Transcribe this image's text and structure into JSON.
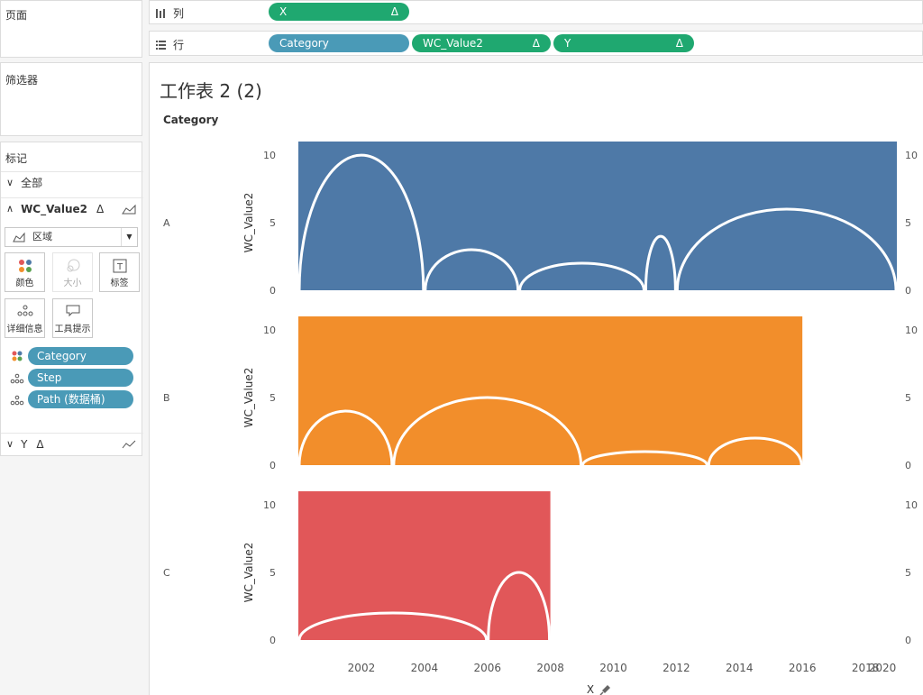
{
  "shelves": {
    "pages_label": "页面",
    "columns_label": "列",
    "rows_label": "行",
    "columns_pills": [
      {
        "label": "X",
        "delta": "Δ"
      }
    ],
    "rows_pills": [
      {
        "label": "Category",
        "delta": ""
      },
      {
        "label": "WC_Value2",
        "delta": "Δ"
      },
      {
        "label": "Y",
        "delta": "Δ"
      }
    ]
  },
  "filters": {
    "title": "筛选器"
  },
  "marks": {
    "title": "标记",
    "all_label": "全部",
    "layer1_label": "WC_Value2",
    "layer1_delta": "Δ",
    "mark_type": "区域",
    "buttons": {
      "color": "颜色",
      "size": "大小",
      "label": "标签",
      "detail": "详细信息",
      "tooltip": "工具提示"
    },
    "fields": [
      {
        "label": "Category",
        "icon": "color-dots-icon"
      },
      {
        "label": "Step",
        "icon": "detail-dots-icon"
      },
      {
        "label": "Path (数据桶)",
        "icon": "detail-dots-icon"
      }
    ],
    "layer2_label": "Y",
    "layer2_delta": "Δ"
  },
  "worksheet": {
    "title": "工作表 2 (2)",
    "facet_header": "Category",
    "x_axis_title": "X",
    "pin_icon": "pin-icon"
  },
  "chart_data": {
    "type": "area",
    "x_field": "X",
    "y_field": "WC_Value2",
    "facet_field": "Category",
    "xlim": [
      2000.5,
      2021
    ],
    "ylim": [
      0,
      11
    ],
    "x_ticks": [
      2002,
      2004,
      2006,
      2008,
      2010,
      2012,
      2014,
      2016,
      2018,
      2020
    ],
    "y_ticks": [
      0,
      5,
      10
    ],
    "colors": {
      "A": "#4e79a7",
      "B": "#f28e2b",
      "C": "#e15759",
      "arc": "#ffffff"
    },
    "facets": [
      {
        "category": "A",
        "area": {
          "x": [
            2001,
            2020
          ],
          "y": 11
        },
        "arcs": [
          [
            2001,
            2005,
            10
          ],
          [
            2005,
            2008,
            3
          ],
          [
            2008,
            2012,
            2
          ],
          [
            2012,
            2013,
            4
          ],
          [
            2013,
            2020,
            6
          ]
        ]
      },
      {
        "category": "B",
        "area": {
          "x": [
            2001,
            2017
          ],
          "y": 11
        },
        "arcs": [
          [
            2001,
            2004,
            4
          ],
          [
            2004,
            2010,
            5
          ],
          [
            2010,
            2014,
            1
          ],
          [
            2014,
            2017,
            2
          ]
        ]
      },
      {
        "category": "C",
        "area": {
          "x": [
            2001,
            2009
          ],
          "y": 11
        },
        "arcs": [
          [
            2001,
            2007,
            2
          ],
          [
            2007,
            2009,
            5
          ]
        ]
      }
    ]
  }
}
